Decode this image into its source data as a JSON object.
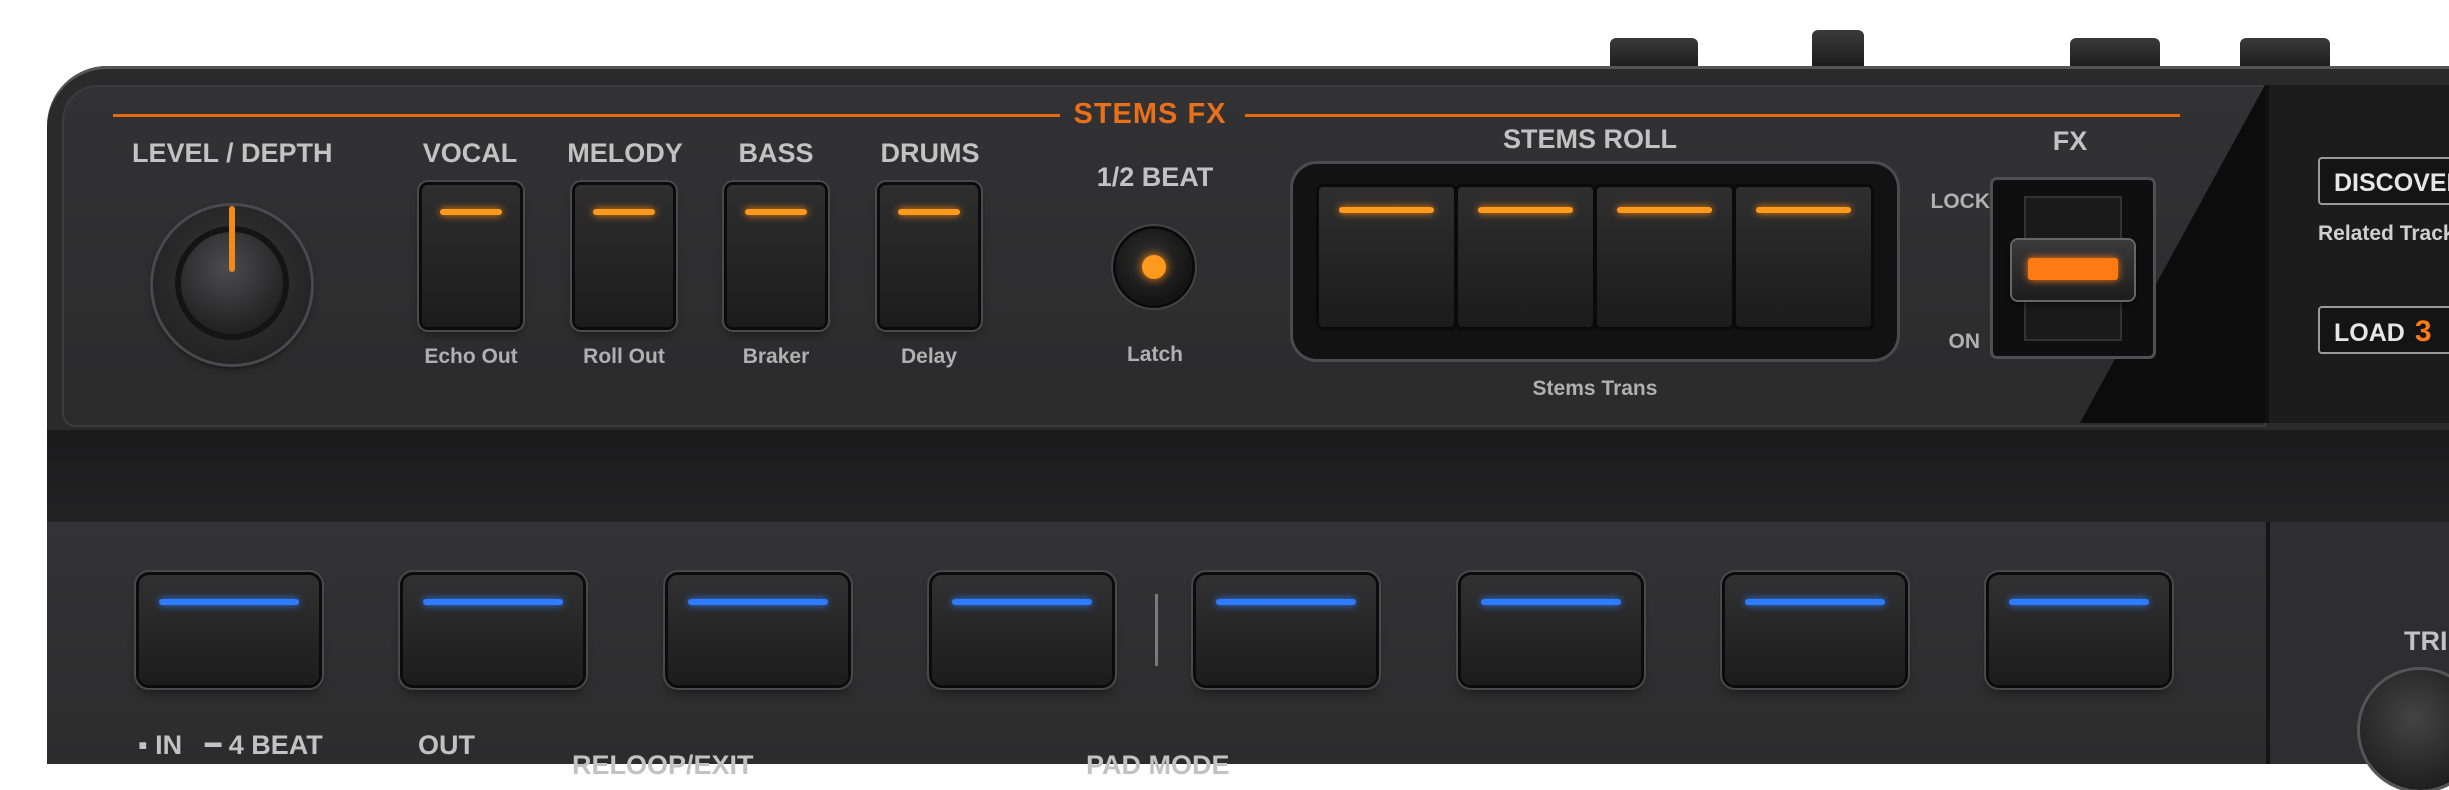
{
  "stems_fx": {
    "title": "STEMS FX",
    "knob_label": "LEVEL / DEPTH",
    "buttons": [
      {
        "label": "VOCAL",
        "sub": "Echo Out"
      },
      {
        "label": "MELODY",
        "sub": "Roll Out"
      },
      {
        "label": "BASS",
        "sub": "Braker"
      },
      {
        "label": "DRUMS",
        "sub": "Delay"
      }
    ],
    "beat_label": "1/2 BEAT",
    "latch_label": "Latch",
    "roll_label": "STEMS ROLL",
    "roll_sub": "Stems Trans",
    "fx_label": "FX",
    "lock_label": "LOCK",
    "on_label": "ON"
  },
  "right_panel": {
    "discover_label": "DISCOVER",
    "related_label": "Related Track",
    "load_label": "LOAD",
    "load_number": "3"
  },
  "bottom": {
    "in_label": "▪ IN",
    "beat_label": "━ 4 BEAT",
    "out_label": "OUT",
    "reloop_label": "RELOOP/EXIT",
    "pad_mode_label": "PAD MODE",
    "trim_label": "TRI"
  },
  "colors": {
    "accent_orange": "#e36a0f",
    "led_orange": "#ff9a1f",
    "led_blue": "#2f7cff"
  }
}
